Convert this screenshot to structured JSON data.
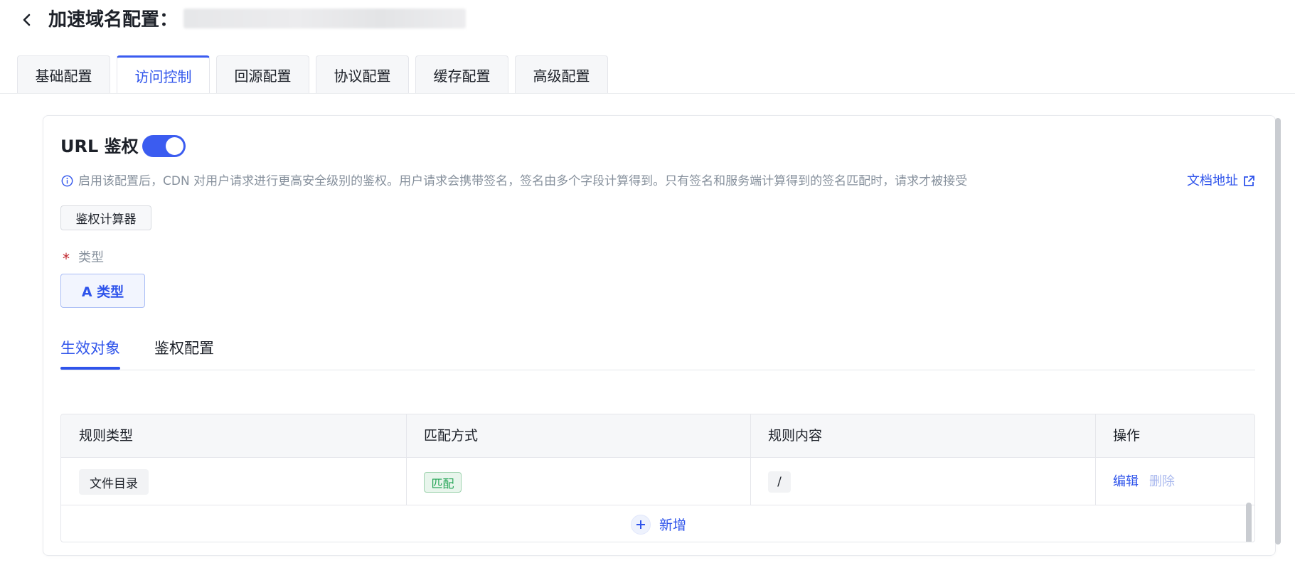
{
  "header": {
    "title": "加速域名配置：",
    "back_icon": "chevron-left-icon"
  },
  "tabs": [
    {
      "label": "基础配置",
      "active": false
    },
    {
      "label": "访问控制",
      "active": true
    },
    {
      "label": "回源配置",
      "active": false
    },
    {
      "label": "协议配置",
      "active": false
    },
    {
      "label": "缓存配置",
      "active": false
    },
    {
      "label": "高级配置",
      "active": false
    }
  ],
  "url_auth": {
    "title": "URL 鉴权",
    "enabled": true,
    "info_text": "启用该配置后，CDN 对用户请求进行更高安全级别的鉴权。用户请求会携带签名，签名由多个字段计算得到。只有签名和服务端计算得到的签名匹配时，请求才被接受",
    "doc_link": "文档地址",
    "calculator_button": "鉴权计算器",
    "required_mark": "*",
    "type_label": "类型",
    "type_option": "A 类型"
  },
  "subtabs": [
    {
      "label": "生效对象",
      "active": true
    },
    {
      "label": "鉴权配置",
      "active": false
    }
  ],
  "table": {
    "headers": [
      "规则类型",
      "匹配方式",
      "规则内容",
      "操作"
    ],
    "rows": [
      {
        "rule_type": "文件目录",
        "match": "匹配",
        "content": "/",
        "edit": "编辑",
        "delete": "删除"
      }
    ],
    "add_label": "新增"
  },
  "colors": {
    "accent": "#2f54eb",
    "toggle_on": "#3b5cf0",
    "match_tag": "#23a455",
    "required": "#c1272d"
  }
}
